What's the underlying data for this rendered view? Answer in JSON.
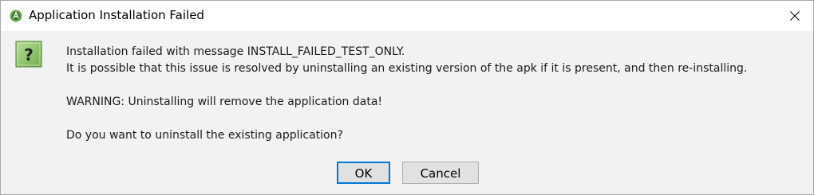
{
  "window": {
    "title": "Application Installation Failed",
    "close_glyph": "✕"
  },
  "icons": {
    "app_icon": "android-studio-icon",
    "question_icon": "question-mark-icon",
    "question_glyph": "?"
  },
  "message": {
    "line1": "Installation failed with message INSTALL_FAILED_TEST_ONLY.",
    "line2": "It is possible that this issue is resolved by uninstalling an existing version of the apk if it is present, and then re-installing.",
    "warning": "WARNING: Uninstalling will remove the application data!",
    "question": "Do you want to uninstall the existing application?"
  },
  "buttons": {
    "ok_label": "OK",
    "cancel_label": "Cancel"
  },
  "colors": {
    "focus_border": "#0078d7",
    "dialog_background": "#f2f2f2",
    "question_icon_green": "#7fba5a"
  }
}
